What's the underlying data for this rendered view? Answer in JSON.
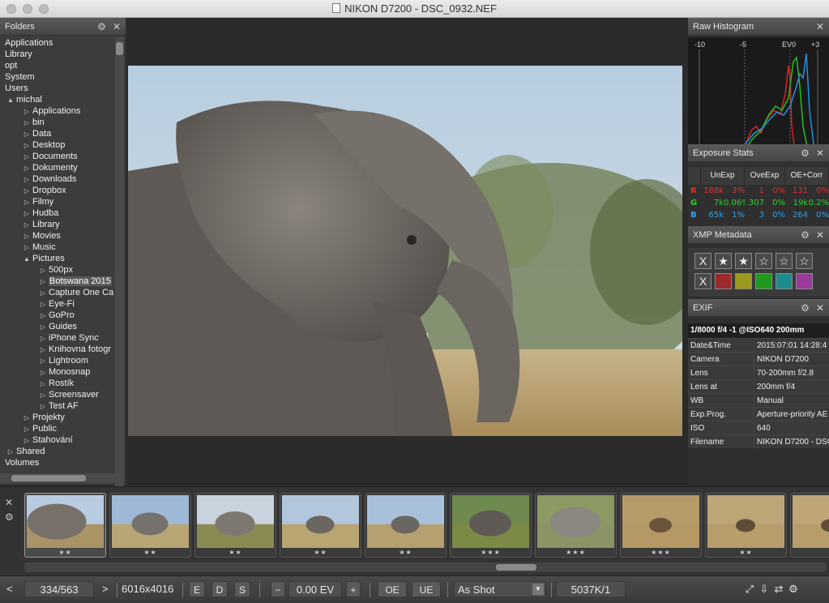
{
  "window": {
    "title": "NIKON D7200 - DSC_0932.NEF"
  },
  "folders": {
    "title": "Folders",
    "items": [
      {
        "label": "Applications",
        "depth": 0,
        "tri": ""
      },
      {
        "label": "Library",
        "depth": 0,
        "tri": ""
      },
      {
        "label": "opt",
        "depth": 0,
        "tri": ""
      },
      {
        "label": "System",
        "depth": 0,
        "tri": ""
      },
      {
        "label": "Users",
        "depth": 0,
        "tri": ""
      },
      {
        "label": "michal",
        "depth": 1,
        "tri": "▲"
      },
      {
        "label": "Applications",
        "depth": 2,
        "tri": "▷"
      },
      {
        "label": "bin",
        "depth": 2,
        "tri": "▷"
      },
      {
        "label": "Data",
        "depth": 2,
        "tri": "▷"
      },
      {
        "label": "Desktop",
        "depth": 2,
        "tri": "▷"
      },
      {
        "label": "Documents",
        "depth": 2,
        "tri": "▷"
      },
      {
        "label": "Dokumenty",
        "depth": 2,
        "tri": "▷"
      },
      {
        "label": "Downloads",
        "depth": 2,
        "tri": "▷"
      },
      {
        "label": "Dropbox",
        "depth": 2,
        "tri": "▷"
      },
      {
        "label": "Filmy",
        "depth": 2,
        "tri": "▷"
      },
      {
        "label": "Hudba",
        "depth": 2,
        "tri": "▷"
      },
      {
        "label": "Library",
        "depth": 2,
        "tri": "▷"
      },
      {
        "label": "Movies",
        "depth": 2,
        "tri": "▷"
      },
      {
        "label": "Music",
        "depth": 2,
        "tri": "▷"
      },
      {
        "label": "Pictures",
        "depth": 2,
        "tri": "▲"
      },
      {
        "label": "500px",
        "depth": 3,
        "tri": "▷"
      },
      {
        "label": "Botswana 2015",
        "depth": 3,
        "tri": "▷",
        "selected": true
      },
      {
        "label": "Capture One Ca",
        "depth": 3,
        "tri": "▷"
      },
      {
        "label": "Eye-Fi",
        "depth": 3,
        "tri": "▷"
      },
      {
        "label": "GoPro",
        "depth": 3,
        "tri": "▷"
      },
      {
        "label": "Guides",
        "depth": 3,
        "tri": "▷"
      },
      {
        "label": "iPhone Sync",
        "depth": 3,
        "tri": "▷"
      },
      {
        "label": "Knihovna fotogr",
        "depth": 3,
        "tri": "▷"
      },
      {
        "label": "Lightroom",
        "depth": 3,
        "tri": "▷"
      },
      {
        "label": "Monosnap",
        "depth": 3,
        "tri": "▷"
      },
      {
        "label": "Rostík",
        "depth": 3,
        "tri": "▷"
      },
      {
        "label": "Screensaver",
        "depth": 3,
        "tri": "▷"
      },
      {
        "label": "Test AF",
        "depth": 3,
        "tri": "▷"
      },
      {
        "label": "Projekty",
        "depth": 2,
        "tri": "▷"
      },
      {
        "label": "Public",
        "depth": 2,
        "tri": "▷"
      },
      {
        "label": "Stahování",
        "depth": 2,
        "tri": "▷"
      },
      {
        "label": "Shared",
        "depth": 1,
        "tri": "▷"
      },
      {
        "label": "Volumes",
        "depth": 0,
        "tri": ""
      }
    ]
  },
  "histogram": {
    "title": "Raw Histogram",
    "labels": [
      "-10",
      "-5",
      "EV0",
      "+3"
    ],
    "colors": {
      "red": "#e02020",
      "green": "#20c020",
      "blue": "#2090e0"
    }
  },
  "exposure": {
    "title": "Exposure Stats",
    "headers": [
      "UnExp",
      "OveExp",
      "OE+Corr"
    ],
    "rows": [
      {
        "ch": "R",
        "color": "#e03030",
        "cells": [
          "188k",
          "3%",
          "1",
          "0%",
          "131",
          "0%"
        ]
      },
      {
        "ch": "G",
        "color": "#30d030",
        "cells": [
          "7k",
          "0.06%",
          "307",
          "0%",
          "19k",
          "0.2%"
        ]
      },
      {
        "ch": "B",
        "color": "#30a0f0",
        "cells": [
          "65k",
          "1%",
          "3",
          "0%",
          "264",
          "0%"
        ]
      }
    ]
  },
  "xmp": {
    "title": "XMP Metadata",
    "rating_buttons": [
      "X",
      "★",
      "★",
      "☆",
      "☆",
      "☆"
    ],
    "label_button": "X",
    "label_colors": [
      "#9b2a2a",
      "#9a9a1e",
      "#1f9a1f",
      "#1e8c8c",
      "#9a3a9a"
    ]
  },
  "exif": {
    "title": "EXIF",
    "summary": "1/8000 f/4 -1 @ISO640 200mm",
    "rows": [
      {
        "k": "Date&Time",
        "v": "2015:07:01 14:28:4"
      },
      {
        "k": "Camera",
        "v": "NIKON D7200"
      },
      {
        "k": "Lens",
        "v": "70-200mm f/2.8"
      },
      {
        "k": "Lens at",
        "v": "200mm f/4"
      },
      {
        "k": "WB",
        "v": "Manual"
      },
      {
        "k": "Exp.Prog.",
        "v": "Aperture-priority AE"
      },
      {
        "k": "ISO",
        "v": "640"
      },
      {
        "k": "Filename",
        "v": "NIKON D7200 - DSC"
      }
    ]
  },
  "filmstrip": {
    "thumbs": [
      {
        "stars": "★★",
        "scene": "elephant-close",
        "active": true
      },
      {
        "stars": "★★",
        "scene": "elephant-walk"
      },
      {
        "stars": "★★",
        "scene": "elephant-front"
      },
      {
        "stars": "★★",
        "scene": "elephant-far"
      },
      {
        "stars": "★★",
        "scene": "elephant-far2"
      },
      {
        "stars": "★★★",
        "scene": "elephant-trees"
      },
      {
        "stars": "★★★",
        "scene": "elephant-head"
      },
      {
        "stars": "★★★",
        "scene": "baboons"
      },
      {
        "stars": "★★",
        "scene": "baboon"
      },
      {
        "stars": "",
        "scene": "baboon2"
      }
    ]
  },
  "toolbar": {
    "prev": "<",
    "counter": "334/563",
    "next": ">",
    "dimensions": "6016x4016",
    "e": "E",
    "d": "D",
    "s": "S",
    "minus": "−",
    "ev": "0.00 EV",
    "plus": "+",
    "oe": "OE",
    "ue": "UE",
    "wb": "As Shot",
    "bitrate": "5037K/1"
  }
}
